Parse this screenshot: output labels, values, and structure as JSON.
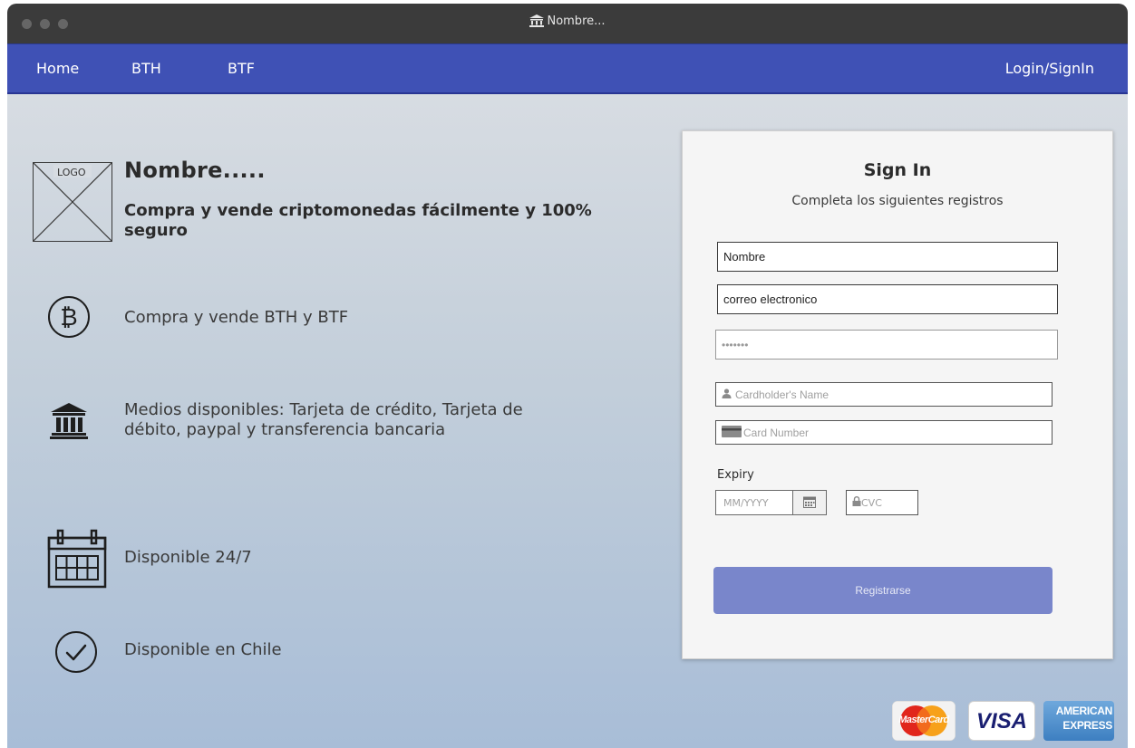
{
  "window": {
    "title": "Nombre..."
  },
  "nav": {
    "home": "Home",
    "bth": "BTH",
    "btf": "BTF",
    "login": "Login/SignIn"
  },
  "hero": {
    "logo_text": "LOGO",
    "title": "Nombre.....",
    "tagline": "Compra y vende criptomonedas fácilmente y 100% seguro"
  },
  "features": [
    {
      "icon": "bitcoin-icon",
      "text": "Compra y vende BTH y BTF"
    },
    {
      "icon": "bank-icon",
      "text": "Medios disponibles: Tarjeta de crédito, Tarjeta de débito, paypal y transferencia bancaria"
    },
    {
      "icon": "calendar-icon",
      "text": "Disponible 24/7"
    },
    {
      "icon": "check-circle-icon",
      "text": "Disponible en Chile"
    }
  ],
  "signin": {
    "title": "Sign In",
    "subtitle": "Completa los siguientes registros",
    "name_value": "Nombre",
    "email_value": "correo electronico",
    "password_value": "•••••••",
    "cardholder_placeholder": "Cardholder's Name",
    "card_number_placeholder": "Card Number",
    "expiry_label": "Expiry",
    "expiry_placeholder": "MM/YYYY",
    "cvc_placeholder": "CVC",
    "submit_label": "Registrarse"
  },
  "payment_logos": {
    "mastercard": "MasterCard",
    "visa": "VISA",
    "amex_line1": "AMERICAN",
    "amex_line2": "EXPRESS"
  },
  "colors": {
    "navbar": "#3f51b5",
    "button": "#7986cb",
    "titlebar": "#3b3b3b"
  }
}
